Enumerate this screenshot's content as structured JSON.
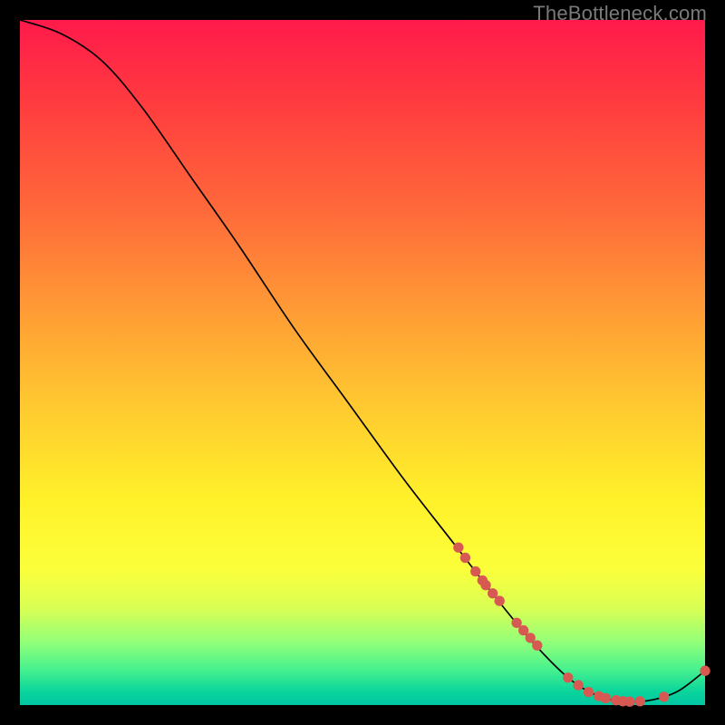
{
  "watermark": "TheBottleneck.com",
  "chart_data": {
    "type": "line",
    "title": "",
    "xlabel": "",
    "ylabel": "",
    "xlim": [
      0,
      100
    ],
    "ylim": [
      0,
      100
    ],
    "grid": false,
    "legend": null,
    "curve": [
      {
        "x": 0,
        "y": 100
      },
      {
        "x": 6,
        "y": 98
      },
      {
        "x": 12,
        "y": 94
      },
      {
        "x": 18,
        "y": 87
      },
      {
        "x": 25,
        "y": 77
      },
      {
        "x": 32,
        "y": 67
      },
      {
        "x": 40,
        "y": 55
      },
      {
        "x": 48,
        "y": 44
      },
      {
        "x": 56,
        "y": 33
      },
      {
        "x": 63,
        "y": 24
      },
      {
        "x": 70,
        "y": 15
      },
      {
        "x": 75,
        "y": 9
      },
      {
        "x": 80,
        "y": 4
      },
      {
        "x": 84,
        "y": 1.5
      },
      {
        "x": 88,
        "y": 0.5
      },
      {
        "x": 92,
        "y": 0.7
      },
      {
        "x": 96,
        "y": 2.0
      },
      {
        "x": 100,
        "y": 5.0
      }
    ],
    "scatter_points": [
      {
        "x": 64,
        "y": 23.0
      },
      {
        "x": 65,
        "y": 21.5
      },
      {
        "x": 66.5,
        "y": 19.5
      },
      {
        "x": 67.5,
        "y": 18.2
      },
      {
        "x": 68,
        "y": 17.5
      },
      {
        "x": 69,
        "y": 16.3
      },
      {
        "x": 70,
        "y": 15.2
      },
      {
        "x": 72.5,
        "y": 12.0
      },
      {
        "x": 73.5,
        "y": 10.9
      },
      {
        "x": 74.5,
        "y": 9.8
      },
      {
        "x": 75.5,
        "y": 8.7
      },
      {
        "x": 80,
        "y": 4.0
      },
      {
        "x": 81.5,
        "y": 2.9
      },
      {
        "x": 83,
        "y": 1.9
      },
      {
        "x": 84.5,
        "y": 1.3
      },
      {
        "x": 85.5,
        "y": 1.0
      },
      {
        "x": 87,
        "y": 0.7
      },
      {
        "x": 88,
        "y": 0.55
      },
      {
        "x": 89,
        "y": 0.5
      },
      {
        "x": 90.5,
        "y": 0.55
      },
      {
        "x": 94,
        "y": 1.2
      },
      {
        "x": 100,
        "y": 5.0
      }
    ],
    "colors": {
      "curve": "#000000",
      "points": "#d65a52"
    }
  }
}
